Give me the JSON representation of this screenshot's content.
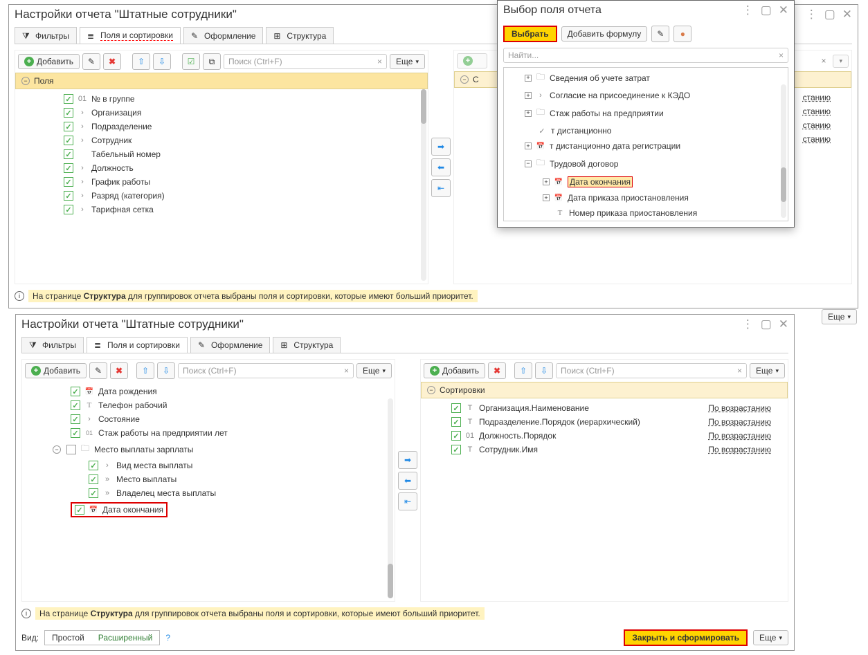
{
  "top": {
    "title": "Настройки отчета \"Штатные сотрудники\"",
    "tabs": {
      "filters": "Фильтры",
      "fields": "Поля и сортировки",
      "design": "Оформление",
      "structure": "Структура"
    },
    "add": "Добавить",
    "more": "Еще",
    "search_ph": "Поиск (Ctrl+F)",
    "fields_header": "Поля",
    "sort_header_bg": "С",
    "bg_text_fragment": "станию",
    "fields": [
      {
        "ic": "01",
        "t": "№ в группе"
      },
      {
        "ic": "›",
        "t": "Организация"
      },
      {
        "ic": "›",
        "t": "Подразделение"
      },
      {
        "ic": "›",
        "t": "Сотрудник"
      },
      {
        "ic": "",
        "t": "Табельный номер"
      },
      {
        "ic": "›",
        "t": "Должность"
      },
      {
        "ic": "›",
        "t": "График работы"
      },
      {
        "ic": "›",
        "t": "Разряд (категория)"
      },
      {
        "ic": "›",
        "t": "Тарифная сетка"
      }
    ],
    "info_a": "На странице ",
    "info_b": "Структура",
    "info_c": " для группировок отчета выбраны поля и сортировки, которые имеют больший приоритет."
  },
  "popup": {
    "title": "Выбор поля отчета",
    "select": "Выбрать",
    "formula": "Добавить формулу",
    "search_ph": "Найти...",
    "tree": [
      {
        "pre": "+",
        "ic": "folder",
        "t": "Сведения об учете затрат",
        "lvl": 1
      },
      {
        "pre": "+",
        "ic": "arrow",
        "t": "Согласие на присоединение к КЭДО",
        "lvl": 1
      },
      {
        "pre": "+",
        "ic": "folder",
        "t": "Стаж работы на предприятии",
        "lvl": 1
      },
      {
        "pre": "",
        "ic": "check",
        "t": "т дистанционно",
        "lvl": 1
      },
      {
        "pre": "+",
        "ic": "date",
        "t": "т дистанционно дата регистрации",
        "lvl": 1
      },
      {
        "pre": "-",
        "ic": "folder",
        "t": "Трудовой договор",
        "lvl": 1
      },
      {
        "pre": "+",
        "ic": "date",
        "t": "Дата окончания",
        "lvl": 2,
        "hl": true
      },
      {
        "pre": "+",
        "ic": "date",
        "t": "Дата приказа приостановления",
        "lvl": 2
      },
      {
        "pre": "",
        "ic": "text",
        "t": "Номер приказа приостановления",
        "lvl": 2
      }
    ]
  },
  "bot": {
    "title": "Настройки отчета \"Штатные сотрудники\"",
    "tabs": {
      "filters": "Фильтры",
      "fields": "Поля и сортировки",
      "design": "Оформление",
      "structure": "Структура"
    },
    "add": "Добавить",
    "more": "Еще",
    "search_ph": "Поиск (Ctrl+F)",
    "sort_header": "Сортировки",
    "fields": [
      {
        "chk": true,
        "ic": "date",
        "t": "Дата рождения",
        "lvl": 1
      },
      {
        "chk": true,
        "ic": "text",
        "t": "Телефон рабочий",
        "lvl": 1
      },
      {
        "chk": true,
        "ic": "arrow",
        "t": "Состояние",
        "lvl": 1
      },
      {
        "chk": true,
        "ic": "01",
        "t": "Стаж работы на предприятии лет",
        "lvl": 1
      },
      {
        "chk": false,
        "ic": "folder",
        "t": "Место выплаты зарплаты",
        "lvl": 0,
        "expand": "-"
      },
      {
        "chk": true,
        "ic": "arrow",
        "t": "Вид места выплаты",
        "lvl": 2
      },
      {
        "chk": true,
        "ic": "dbl",
        "t": "Место выплаты",
        "lvl": 2
      },
      {
        "chk": true,
        "ic": "dbl",
        "t": "Владелец места выплаты",
        "lvl": 2
      },
      {
        "chk": true,
        "ic": "date",
        "t": "Дата окончания",
        "lvl": 1,
        "hl": true
      }
    ],
    "sorts": [
      {
        "ic": "T",
        "t": "Организация.Наименование",
        "dir": "По возрастанию"
      },
      {
        "ic": "T",
        "t": "Подразделение.Порядок (иерархический)",
        "dir": "По возрастанию"
      },
      {
        "ic": "01",
        "t": "Должность.Порядок",
        "dir": "По возрастанию"
      },
      {
        "ic": "T",
        "t": "Сотрудник.Имя",
        "dir": "По возрастанию"
      }
    ],
    "info_a": "На странице ",
    "info_b": "Структура",
    "info_c": " для группировок отчета выбраны поля и сортировки, которые имеют больший приоритет.",
    "view_lbl": "Вид:",
    "simple": "Простой",
    "adv": "Расширенный",
    "close_gen": "Закрыть и сформировать",
    "ext_more": "Еще"
  }
}
